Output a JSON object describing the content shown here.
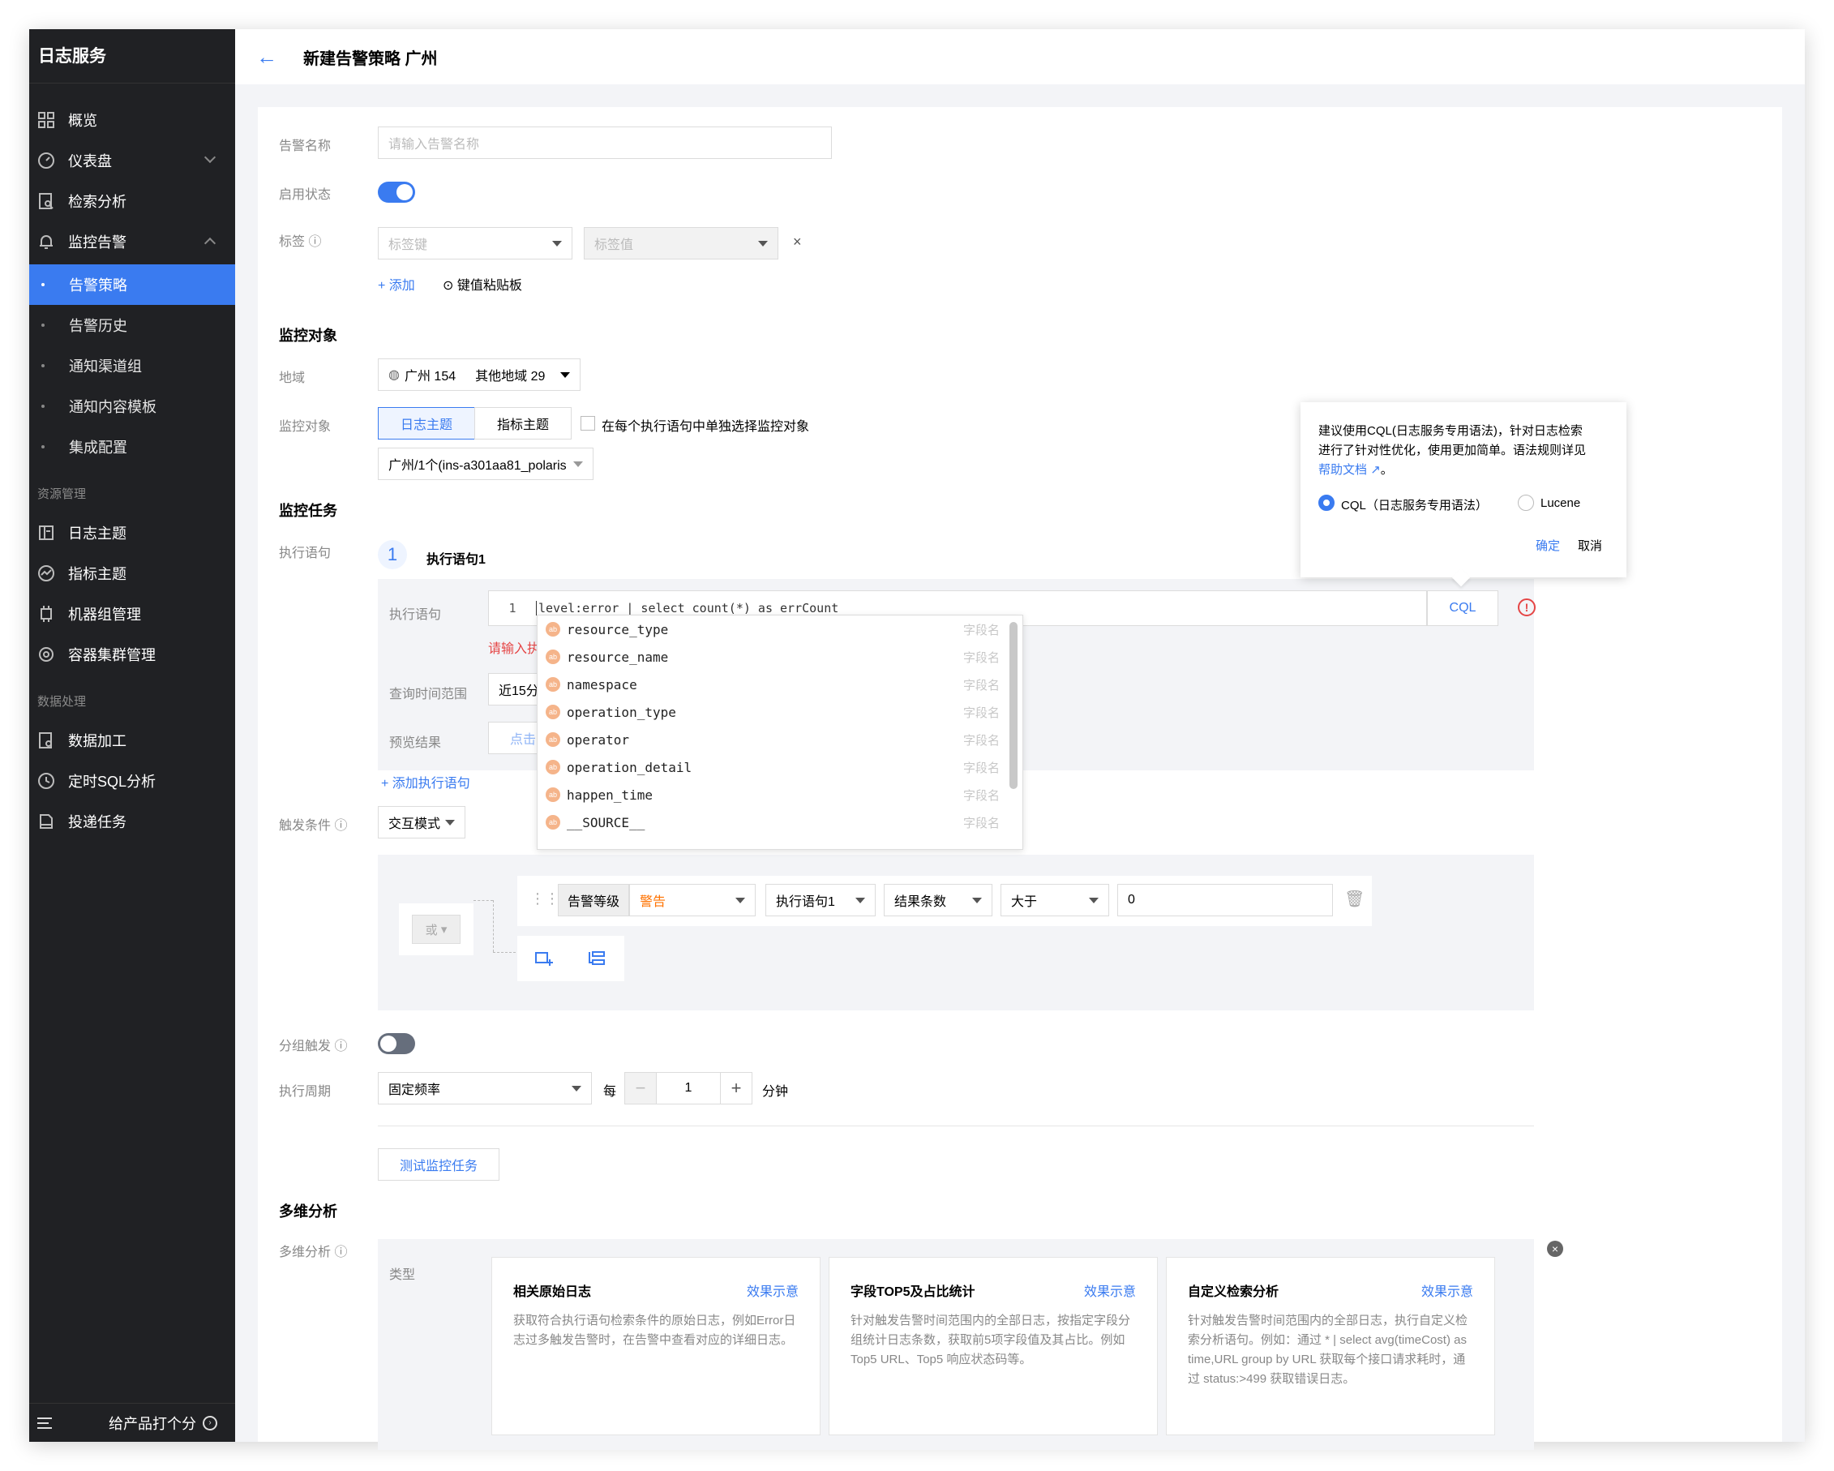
{
  "sidebar": {
    "title": "日志服务",
    "items": [
      {
        "label": "概览",
        "icon": "grid-icon"
      },
      {
        "label": "仪表盘",
        "icon": "dashboard-icon"
      },
      {
        "label": "检索分析",
        "icon": "search-doc-icon"
      },
      {
        "label": "监控告警",
        "icon": "bell-icon"
      }
    ],
    "sub_items": [
      "告警策略",
      "告警历史",
      "通知渠道组",
      "通知内容模板",
      "集成配置"
    ],
    "section_resource": "资源管理",
    "resource_items": [
      "日志主题",
      "指标主题",
      "机器组管理",
      "容器集群管理"
    ],
    "section_data": "数据处理",
    "data_items": [
      "数据加工",
      "定时SQL分析",
      "投递任务"
    ],
    "footer_rate": "给产品打个分"
  },
  "header": {
    "title": "新建告警策略 广州"
  },
  "form": {
    "alarm_name_label": "告警名称",
    "alarm_name_placeholder": "请输入告警名称",
    "enable_label": "启用状态",
    "tag_label": "标签",
    "tag_key_placeholder": "标签键",
    "tag_value_placeholder": "标签值",
    "add_label": "添加",
    "paste_label": "键值粘贴板",
    "monitor_object_title": "监控对象",
    "region_label": "地域",
    "region_value": "广州 154",
    "region_other": "其他地域 29",
    "monitor_object_label": "监控对象",
    "tab_log_topic": "日志主题",
    "tab_metric_topic": "指标主题",
    "checkbox_label": "在每个执行语句中单独选择监控对象",
    "topic_select_value": "广州/1个(ins-a301aa81_polaris",
    "monitor_task_title": "监控任务",
    "exec_statement_label": "执行语句",
    "statement_name": "执行语句1",
    "statement_index": "1",
    "inner_exec_label": "执行语句",
    "line_number": "1",
    "query_text": "level:error | select count(*) as errCount",
    "cql_button": "CQL",
    "error_hint": "请输入执",
    "time_range_label": "查询时间范围",
    "time_range_value": "近15分",
    "preview_label": "预览结果",
    "preview_link": "点击",
    "add_statement": "添加执行语句",
    "trigger_label": "触发条件",
    "trigger_mode": "交互模式",
    "or_label": "或",
    "alarm_level_label": "告警等级",
    "alarm_level_value": "警告",
    "cond_statement": "执行语句1",
    "cond_metric": "结果条数",
    "cond_operator": "大于",
    "cond_value": "0",
    "group_trigger_label": "分组触发",
    "period_label": "执行周期",
    "period_mode": "固定频率",
    "every_label": "每",
    "period_value": "1",
    "minute_label": "分钟",
    "test_button": "测试监控任务",
    "multi_title": "多维分析",
    "multi_label": "多维分析",
    "type_label": "类型"
  },
  "autocomplete": {
    "type_label": "字段名",
    "fields": [
      "resource_type",
      "resource_name",
      "namespace",
      "operation_type",
      "operator",
      "operation_detail",
      "happen_time",
      "__SOURCE__"
    ]
  },
  "popover": {
    "text_line1": "建议使用CQL(日志服务专用语法)，针对日志检索",
    "text_line2": "进行了针对性优化，使用更加简单。语法规则详见",
    "help_link": "帮助文档",
    "period": "。",
    "option_cql": "CQL（日志服务专用语法）",
    "option_lucene": "Lucene",
    "confirm": "确定",
    "cancel": "取消"
  },
  "analysis_cards": [
    {
      "title": "相关原始日志",
      "link": "效果示意",
      "desc": "获取符合执行语句检索条件的原始日志，例如Error日志过多触发告警时，在告警中查看对应的详细日志。"
    },
    {
      "title": "字段TOP5及占比统计",
      "link": "效果示意",
      "desc": "针对触发告警时间范围内的全部日志，按指定字段分组统计日志条数，获取前5项字段值及其占比。例如Top5 URL、Top5 响应状态码等。"
    },
    {
      "title": "自定义检索分析",
      "link": "效果示意",
      "desc": "针对触发告警时间范围内的全部日志，执行自定义检索分析语句。例如：通过 * | select avg(timeCost) as time,URL group by URL 获取每个接口请求耗时，通过 status:>499 获取错误日志。"
    }
  ],
  "colors": {
    "accent": "#3a7bf0",
    "sidebar_bg": "#202124",
    "error": "#e54545",
    "warning": "#ff7200"
  }
}
